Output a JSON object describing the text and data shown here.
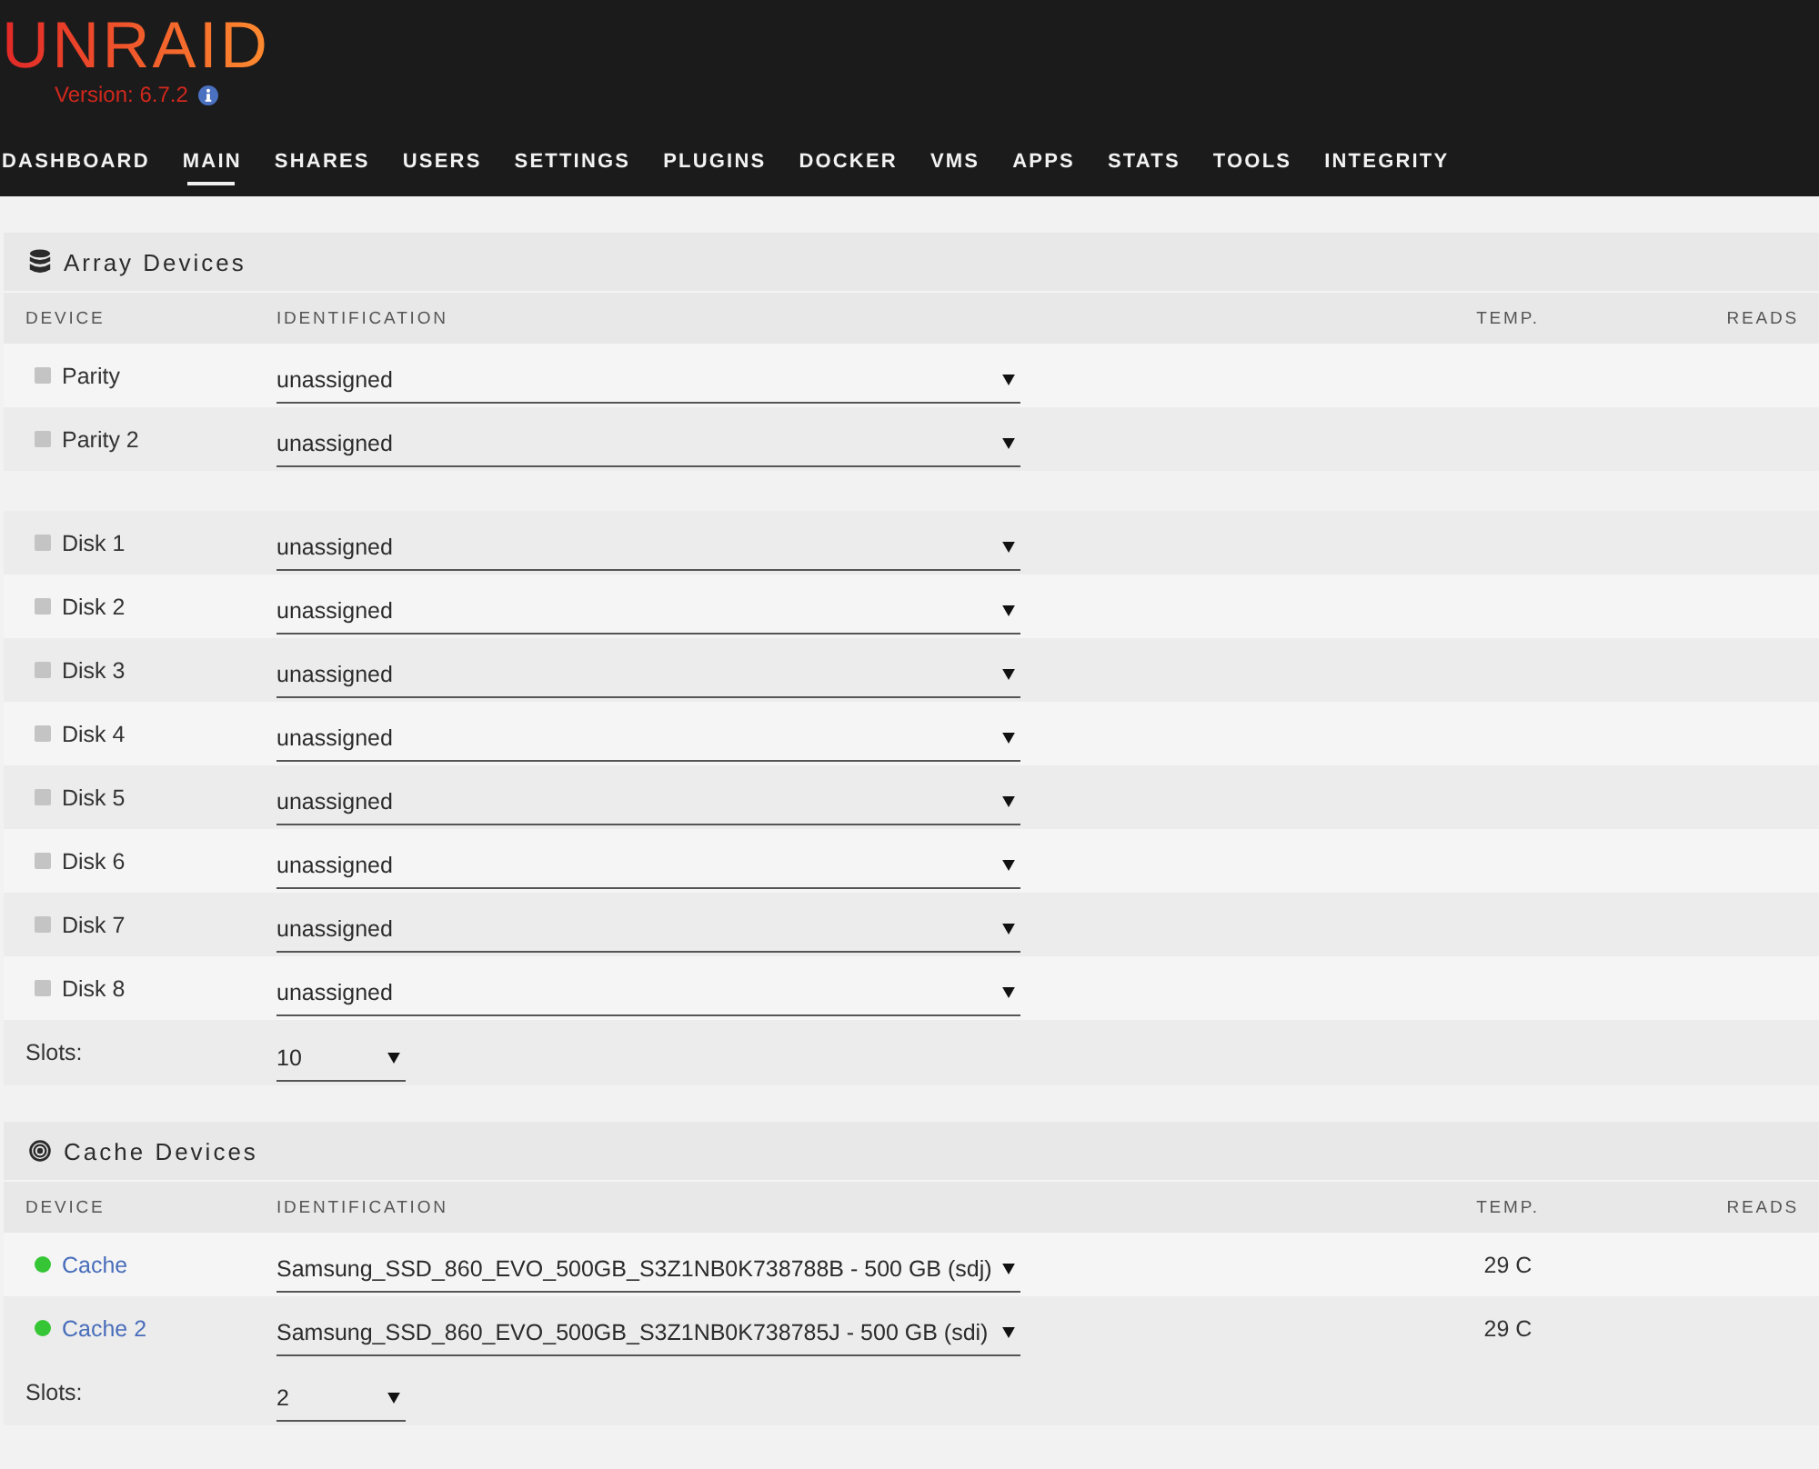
{
  "logo": {
    "text": "UNRAID",
    "version": "Version: 6.7.2"
  },
  "nav": [
    {
      "label": "DASHBOARD",
      "selected": false
    },
    {
      "label": "MAIN",
      "selected": true
    },
    {
      "label": "SHARES",
      "selected": false
    },
    {
      "label": "USERS",
      "selected": false
    },
    {
      "label": "SETTINGS",
      "selected": false
    },
    {
      "label": "PLUGINS",
      "selected": false
    },
    {
      "label": "DOCKER",
      "selected": false
    },
    {
      "label": "VMS",
      "selected": false
    },
    {
      "label": "APPS",
      "selected": false
    },
    {
      "label": "STATS",
      "selected": false
    },
    {
      "label": "TOOLS",
      "selected": false
    },
    {
      "label": "INTEGRITY",
      "selected": false
    }
  ],
  "sections": [
    {
      "kind": "array",
      "title": "Array Devices",
      "columns": [
        "DEVICE",
        "IDENTIFICATION",
        "TEMP.",
        "READS"
      ],
      "groups": [
        [
          {
            "name": "Parity",
            "assigned": false,
            "identification": "unassigned"
          },
          {
            "name": "Parity 2",
            "assigned": false,
            "identification": "unassigned"
          }
        ],
        [
          {
            "name": "Disk 1",
            "assigned": false,
            "identification": "unassigned"
          },
          {
            "name": "Disk 2",
            "assigned": false,
            "identification": "unassigned"
          },
          {
            "name": "Disk 3",
            "assigned": false,
            "identification": "unassigned"
          },
          {
            "name": "Disk 4",
            "assigned": false,
            "identification": "unassigned"
          },
          {
            "name": "Disk 5",
            "assigned": false,
            "identification": "unassigned"
          },
          {
            "name": "Disk 6",
            "assigned": false,
            "identification": "unassigned"
          },
          {
            "name": "Disk 7",
            "assigned": false,
            "identification": "unassigned"
          },
          {
            "name": "Disk 8",
            "assigned": false,
            "identification": "unassigned"
          }
        ]
      ],
      "slots": {
        "label": "Slots:",
        "value": "10"
      }
    },
    {
      "kind": "cache",
      "title": "Cache Devices",
      "columns": [
        "DEVICE",
        "IDENTIFICATION",
        "TEMP.",
        "READS"
      ],
      "groups": [
        [
          {
            "name": "Cache",
            "assigned": true,
            "identification": "Samsung_SSD_860_EVO_500GB_S3Z1NB0K738788B - 500 GB (sdj)",
            "temp": "29 C"
          },
          {
            "name": "Cache 2",
            "assigned": true,
            "identification": "Samsung_SSD_860_EVO_500GB_S3Z1NB0K738785J - 500 GB (sdi)",
            "temp": "29 C"
          }
        ]
      ],
      "slots": {
        "label": "Slots:",
        "value": "2"
      }
    }
  ]
}
